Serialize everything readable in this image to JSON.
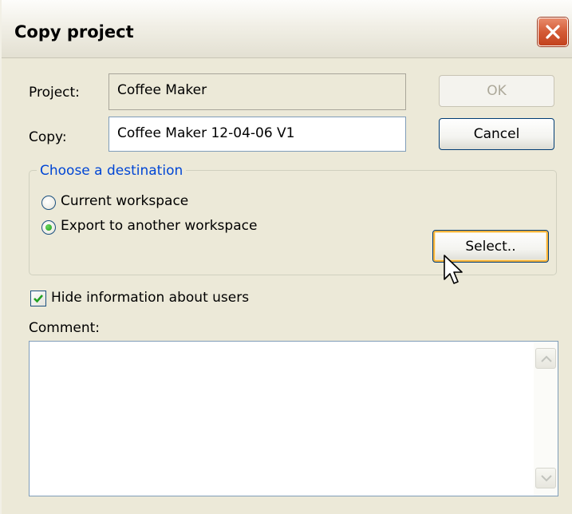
{
  "window": {
    "title": "Copy project"
  },
  "form": {
    "project_label": "Project:",
    "project_value": "Coffee Maker",
    "copy_label": "Copy:",
    "copy_value": "Coffee Maker 12-04-06 V1"
  },
  "buttons": {
    "ok": "OK",
    "cancel": "Cancel",
    "select": "Select.."
  },
  "destination": {
    "legend": "Choose a destination",
    "options": [
      {
        "label": "Current workspace",
        "selected": false
      },
      {
        "label": "Export to another workspace",
        "selected": true
      }
    ]
  },
  "hide_users": {
    "label": "Hide information about users",
    "checked": true
  },
  "comment": {
    "label": "Comment:",
    "value": ""
  },
  "icons": {
    "close": "close-x-icon",
    "checkmark": "checkmark-icon",
    "scroll_up": "scroll-up-arrow-icon",
    "scroll_down": "scroll-down-arrow-icon",
    "cursor": "mouse-pointer-icon"
  },
  "colors": {
    "legend_text": "#0046d5",
    "close_button": "#d45b36",
    "window_bg": "#ece9d8"
  }
}
